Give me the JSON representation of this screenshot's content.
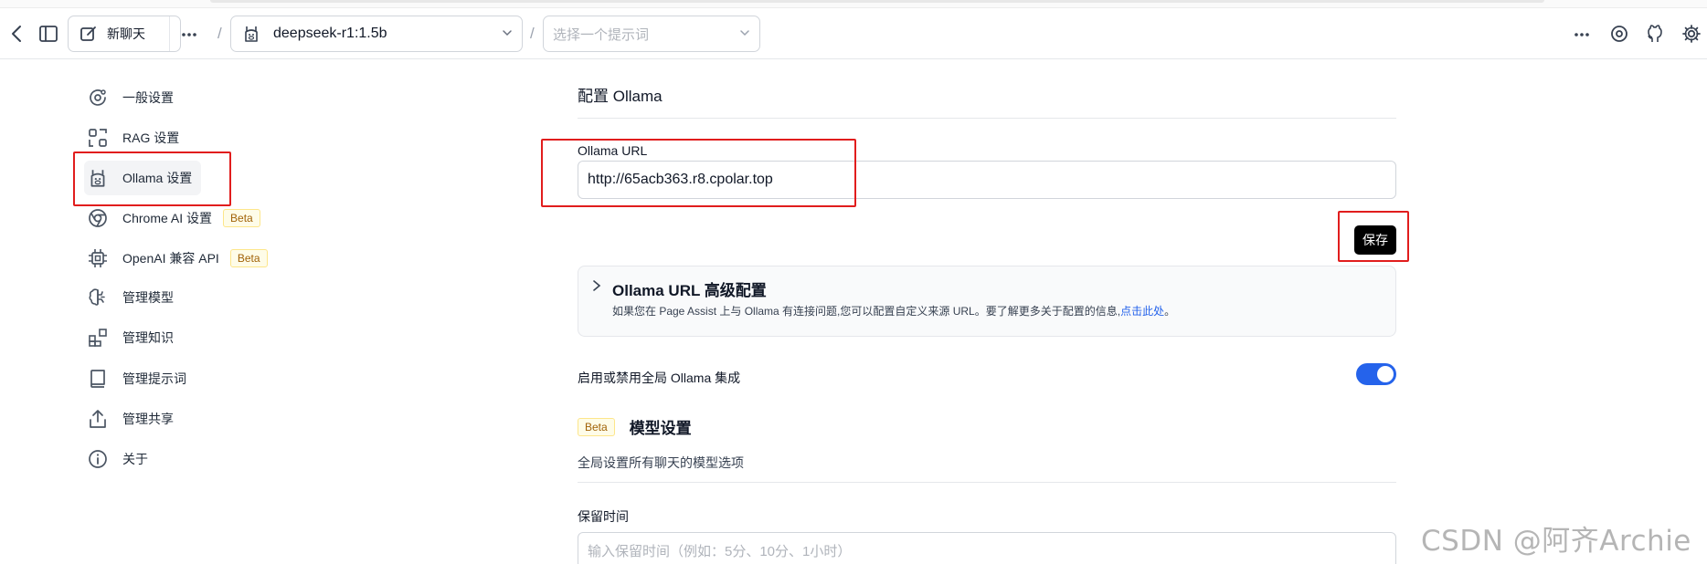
{
  "header": {
    "new_chat_label": "新聊天",
    "model_selected": "deepseek-r1:1.5b",
    "prompt_placeholder": "选择一个提示词",
    "breadcrumb_separator": "/"
  },
  "sidebar": {
    "items": [
      {
        "label": "一般设置",
        "icon": "settings-orbit-icon"
      },
      {
        "label": "RAG 设置",
        "icon": "rag-icon"
      },
      {
        "label": "Ollama 设置",
        "icon": "ollama-llama-icon",
        "active": true
      },
      {
        "label": "Chrome AI 设置",
        "icon": "chrome-icon",
        "badge": "Beta"
      },
      {
        "label": "OpenAI 兼容 API",
        "icon": "cpu-icon",
        "badge": "Beta"
      },
      {
        "label": "管理模型",
        "icon": "brain-icon"
      },
      {
        "label": "管理知识",
        "icon": "blocks-icon"
      },
      {
        "label": "管理提示词",
        "icon": "book-icon"
      },
      {
        "label": "管理共享",
        "icon": "share-icon"
      },
      {
        "label": "关于",
        "icon": "info-icon"
      }
    ]
  },
  "main": {
    "section_title": "配置 Ollama",
    "url_label": "Ollama URL",
    "url_value": "http://65acb363.r8.cpolar.top",
    "save_label": "保存",
    "advanced": {
      "title": "Ollama URL 高级配置",
      "desc_prefix": "如果您在 Page Assist 上与 Ollama 有连接问题,您可以配置自定义来源 URL。要了解更多关于配置的信息,",
      "link_text": "点击此处",
      "desc_suffix": "。"
    },
    "toggle_label": "启用或禁用全局 Ollama 集成",
    "toggle_on": true,
    "model_badge": "Beta",
    "model_title": "模型设置",
    "model_subtitle": "全局设置所有聊天的模型选项",
    "keep_alive_label": "保留时间",
    "keep_alive_placeholder": "输入保留时间（例如：5分、10分、1小时）"
  },
  "watermark": "CSDN @阿齐Archie",
  "colors": {
    "highlight": "#e11d1d",
    "toggle_on": "#2563eb",
    "link": "#2563eb",
    "save_button": "#000000"
  }
}
